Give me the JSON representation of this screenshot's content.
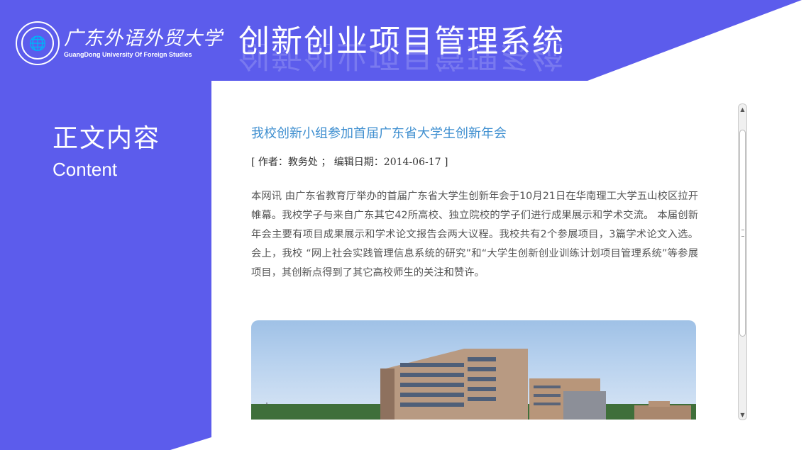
{
  "header": {
    "university_name_cn": "广东外语外贸大学",
    "university_name_en": "GuangDong University Of Foreign Studies",
    "system_title": "创新创业项目管理系统"
  },
  "section": {
    "title": "正文内容",
    "subtitle": "Content"
  },
  "article": {
    "title": "我校创新小组参加首届广东省大学生创新年会",
    "meta": "[ 作者：教务处 ； 编辑日期：2014-06-17 ]",
    "body": "本网讯 由广东省教育厅举办的首届广东省大学生创新年会于10月21日在华南理工大学五山校区拉开帷幕。我校学子与来自广东其它42所高校、独立院校的学子们进行成果展示和学术交流。 本届创新年会主要有项目成果展示和学术论文报告会两大议程。我校共有2个参展项目，3篇学术论文入选。会上，我校 “网上社会实践管理信息系统的研究”和“大学生创新创业训练计划项目管理系统”等参展项目，其创新点得到了其它高校师生的关注和赞许。"
  },
  "colors": {
    "brand": "#5c5cec",
    "title_link": "#3f8fd0",
    "text": "#555555"
  },
  "icons": {
    "scroll_up": "triangle-up",
    "scroll_down": "triangle-down"
  }
}
